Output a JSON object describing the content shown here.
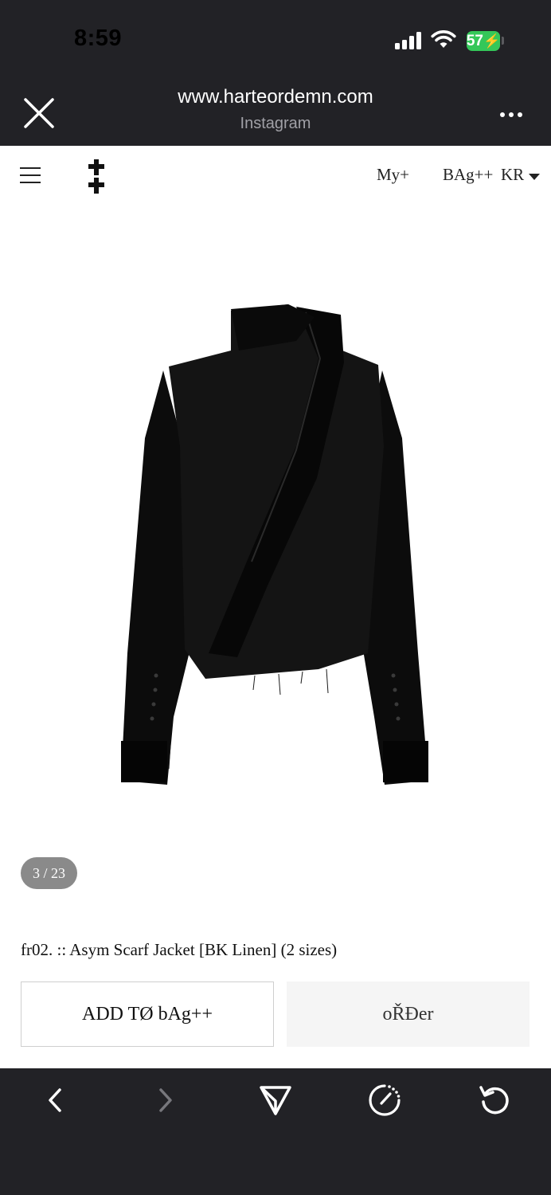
{
  "status_bar": {
    "time": "8:59",
    "battery": "57",
    "icons": [
      "signal-icon",
      "wifi-icon",
      "battery-charging-icon"
    ]
  },
  "browser_header": {
    "url": "www.harteordemn.com",
    "source": "Instagram",
    "icons": [
      "close-icon",
      "more-options-icon"
    ]
  },
  "site_header": {
    "icons": [
      "menu-icon",
      "brand-logo"
    ],
    "my_label": "My+",
    "bag_label": "BAg++",
    "currency_label": "KR"
  },
  "product": {
    "image_counter": "3 / 23",
    "title": "fr02. :: Asym Scarf Jacket [BK Linen] (2 sizes)"
  },
  "actions": {
    "add_label": "ADD TØ bAg++",
    "order_label": "oŘĐer"
  },
  "toolbar": {
    "icons": [
      "back-icon",
      "forward-icon",
      "share-icon",
      "compass-icon",
      "reload-icon"
    ]
  },
  "colors": {
    "chrome_bg": "#222226",
    "battery_green": "#34c759",
    "counter_bg": "#8a8a8a"
  }
}
